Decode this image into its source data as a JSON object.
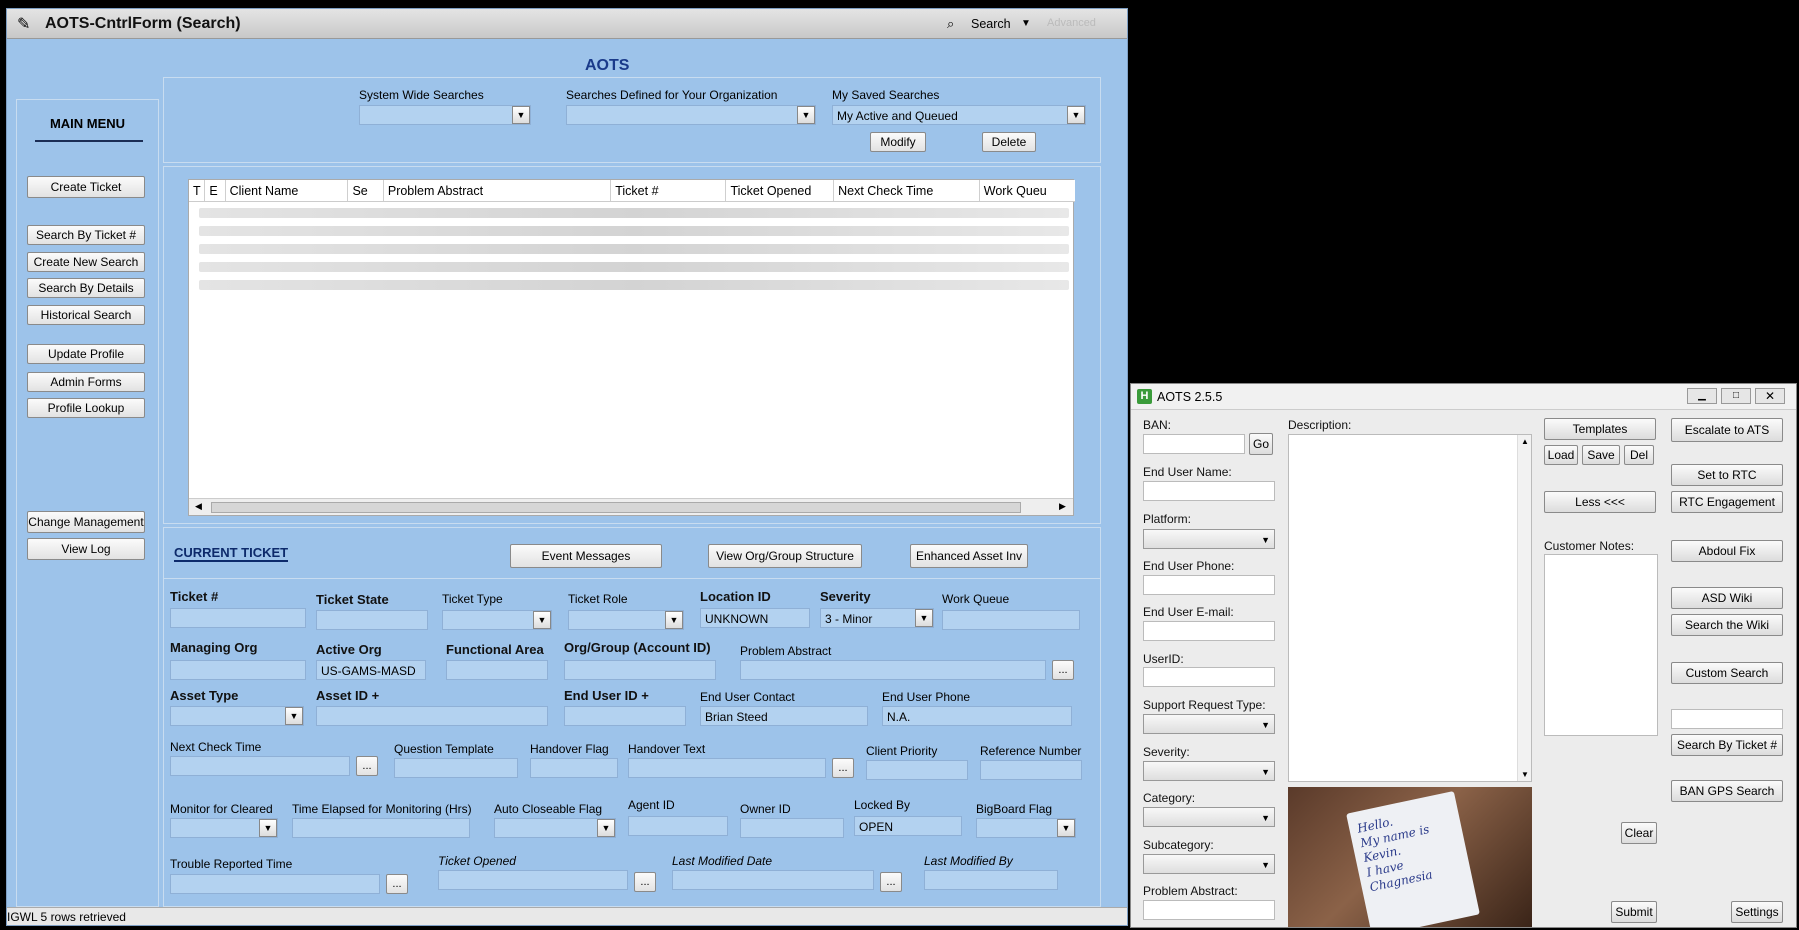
{
  "main": {
    "title": "AOTS-CntrlForm (Search)",
    "search_menu": "Search",
    "advanced": "Advanced",
    "heading": "AOTS",
    "status_bar": "IGWL 5 rows retrieved"
  },
  "menu": {
    "title": "MAIN MENU",
    "items": [
      "Create Ticket",
      "Search By Ticket #",
      "Create New Search",
      "Search By Details",
      "Historical Search",
      "Update Profile",
      "Admin Forms",
      "Profile Lookup",
      "Change Management",
      "View Log"
    ]
  },
  "searches": {
    "system_label": "System Wide Searches",
    "org_label": "Searches Defined for Your Organization",
    "saved_label": "My Saved Searches",
    "saved_value": "My Active and Queued",
    "modify": "Modify",
    "delete": "Delete"
  },
  "grid": {
    "columns": [
      "T",
      "E",
      "Client Name",
      "Se",
      "Problem Abstract",
      "Ticket #",
      "Ticket Opened",
      "Next Check Time",
      "Work Queu"
    ]
  },
  "current": {
    "title": "CURRENT TICKET",
    "event_messages": "Event Messages",
    "view_org": "View Org/Group Structure",
    "enhanced_asset": "Enhanced Asset Inv",
    "ticket_no": "Ticket #",
    "ticket_state": "Ticket State",
    "ticket_type": "Ticket Type",
    "ticket_role": "Ticket Role",
    "location_id": "Location ID",
    "location_value": "UNKNOWN",
    "severity": "Severity",
    "severity_value": "3 - Minor",
    "work_queue": "Work Queue",
    "managing_org": "Managing Org",
    "active_org": "Active Org",
    "active_org_value": "US-GAMS-MASD",
    "functional_area": "Functional Area",
    "org_group": "Org/Group (Account ID)",
    "problem_abstract": "Problem Abstract",
    "asset_type": "Asset Type",
    "asset_id": "Asset ID +",
    "end_user_id": "End User ID +",
    "end_user_contact": "End User Contact",
    "end_user_contact_value": "Brian Steed",
    "end_user_phone": "End User Phone",
    "end_user_phone_value": "N.A.",
    "next_check": "Next Check Time",
    "question_template": "Question Template",
    "handover_flag": "Handover Flag",
    "handover_text": "Handover Text",
    "client_priority": "Client Priority",
    "reference_number": "Reference Number",
    "monitor_cleared": "Monitor for Cleared",
    "time_elapsed": "Time Elapsed for Monitoring (Hrs)",
    "auto_closeable": "Auto Closeable Flag",
    "agent_id": "Agent ID",
    "owner_id": "Owner ID",
    "locked_by": "Locked By",
    "locked_by_value": "OPEN",
    "bigboard": "BigBoard Flag",
    "trouble_reported": "Trouble Reported Time",
    "ticket_opened": "Ticket Opened",
    "last_modified_date": "Last Modified Date",
    "last_modified_by": "Last Modified By",
    "ellipsis": "..."
  },
  "aots": {
    "title": "AOTS 2.5.5",
    "ban": "BAN:",
    "go": "Go",
    "end_user_name": "End User Name:",
    "platform": "Platform:",
    "end_user_phone": "End User Phone:",
    "end_user_email": "End User E-mail:",
    "userid": "UserID:",
    "support_request_type": "Support Request Type:",
    "severity": "Severity:",
    "category": "Category:",
    "subcategory": "Subcategory:",
    "problem_abstract": "Problem Abstract:",
    "description": "Description:",
    "templates": "Templates",
    "load": "Load",
    "save": "Save",
    "del": "Del",
    "less": "Less <<<",
    "customer_notes": "Customer Notes:",
    "escalate": "Escalate to ATS",
    "set_rtc": "Set to RTC",
    "rtc_engagement": "RTC Engagement",
    "abdoul_fix": "Abdoul Fix",
    "asd_wiki": "ASD Wiki",
    "search_wiki": "Search the Wiki",
    "custom_search": "Custom Search",
    "search_ticket": "Search By Ticket #",
    "ban_gps": "BAN GPS Search",
    "clear": "Clear",
    "submit": "Submit",
    "settings": "Settings",
    "note_lines": [
      "Hello.",
      "My name is",
      "Kevin.",
      "I have",
      "Chagnesia"
    ]
  },
  "colors": {
    "main_bg": "#9dc3ea",
    "heading": "#1a3a8a",
    "field": "#b3d2f0"
  },
  "icons": {
    "app": "form-icon",
    "search": "binoculars-icon",
    "aots_app": "h-logo-icon"
  }
}
